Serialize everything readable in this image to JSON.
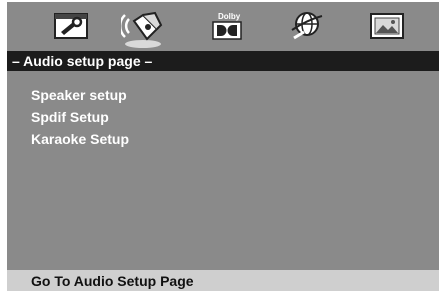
{
  "tabs": [
    {
      "icon": "wrench-settings-icon",
      "active": false
    },
    {
      "icon": "speaker-audio-icon",
      "active": true
    },
    {
      "icon": "dolby-icon",
      "label": "Dolby",
      "active": false
    },
    {
      "icon": "globe-disc-icon",
      "active": false
    },
    {
      "icon": "picture-video-icon",
      "active": false
    }
  ],
  "page": {
    "title": "– Audio setup page –"
  },
  "menu": {
    "items": [
      {
        "label": "Speaker setup"
      },
      {
        "label": "Spdif Setup"
      },
      {
        "label": "Karaoke Setup"
      }
    ]
  },
  "status": {
    "text": "Go To Audio Setup Page"
  },
  "colors": {
    "background": "#8a8a8a",
    "title_bar": "#1c1c1c",
    "status_bar": "#cfcfcf",
    "text": "#ffffff"
  }
}
